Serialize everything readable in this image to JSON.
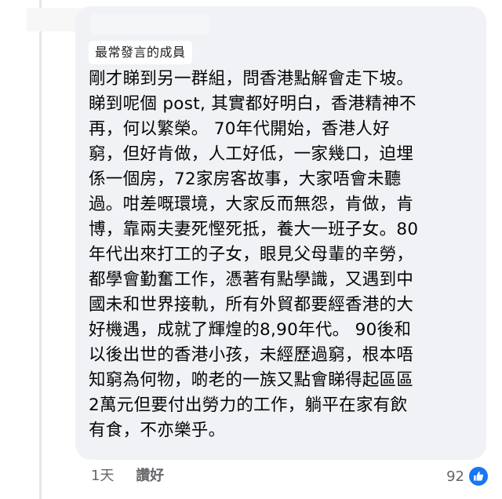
{
  "comment": {
    "badge": "最常發言的成員",
    "lines": [
      "剛才睇到另一群組，問香港點解會走下坡。",
      "睇到呢個 post, 其實都好明白，香港精神不",
      "再，何以繁榮。   70年代開始，香港人好",
      "窮，但好肯做，人工好低，一家幾口，迫埋",
      "係一個房，72家房客故事，大家唔會未聽",
      "過。咁差嘅環境，大家反而無怨，肯做，肯",
      "博，靠兩夫妻死慳死抵，養大一班子女。80",
      "年代出來打工的子女，眼見父母輩的辛勞，",
      "都學會勤奮工作，憑著有點學識，又遇到中",
      "國未和世界接軌，所有外貿都要經香港的大",
      "好機遇，成就了輝煌的8,90年代。  90後和",
      "以後出世的香港小孩，未經歷過窮，根本唔",
      "知窮為何物，啲老的一族又點會睇得起區區",
      "2萬元但要付出勞力的工作，躺平在家有飲",
      "有食，不亦樂乎。"
    ]
  },
  "footer": {
    "time": "1天",
    "like_label": "讚好",
    "reaction_count": "92"
  },
  "colors": {
    "bubble": "#f0f2f5",
    "like_blue": "#1877f2",
    "meta_gray": "#65676b"
  },
  "icons": {
    "reaction": "like-thumbs-up-icon"
  }
}
